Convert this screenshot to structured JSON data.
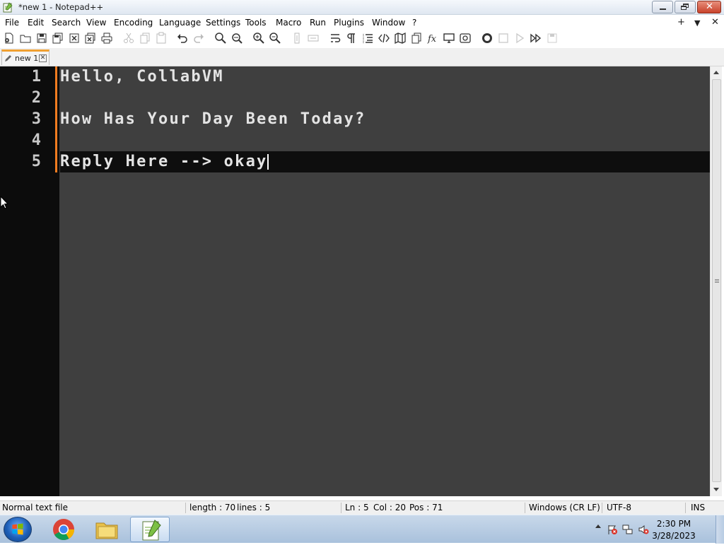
{
  "window": {
    "title": "*new 1 - Notepad++"
  },
  "menubar": {
    "items": [
      "File",
      "Edit",
      "Search",
      "View",
      "Encoding",
      "Language",
      "Settings",
      "Tools",
      "Macro",
      "Run",
      "Plugins",
      "Window",
      "?"
    ],
    "right_controls": [
      "+",
      "▼",
      "✕"
    ]
  },
  "toolbar": {
    "icons": [
      "new-file-icon",
      "open-file-icon",
      "save-icon",
      "save-all-icon",
      "close-icon",
      "close-all-icon",
      "print-icon",
      "cut-icon",
      "copy-icon",
      "paste-icon",
      "undo-icon",
      "redo-icon",
      "find-icon",
      "replace-icon",
      "zoom-in-icon",
      "zoom-out-icon",
      "sync-vertical-icon",
      "sync-horizontal-icon",
      "word-wrap-icon",
      "show-all-characters-icon",
      "indent-guide-icon",
      "xml-tag-icon",
      "document-map-icon",
      "document-list-icon",
      "function-list-icon",
      "monitoring-icon",
      "folder-as-workspace-icon",
      "record-macro-icon",
      "stop-recording-icon",
      "playback-icon",
      "run-macro-multiple-icon",
      "save-macro-icon"
    ]
  },
  "tab": {
    "label": "new 1",
    "close_symbol": "✕"
  },
  "editor": {
    "lines": [
      {
        "number": "1",
        "text": "Hello, CollabVM"
      },
      {
        "number": "2",
        "text": ""
      },
      {
        "number": "3",
        "text": "How Has Your Day Been Today?"
      },
      {
        "number": "4",
        "text": ""
      },
      {
        "number": "5",
        "text": "Reply Here --> okay"
      }
    ],
    "current_line_index": 4
  },
  "statusbar": {
    "file_type": "Normal text file",
    "length": "length : 70",
    "lines": "lines : 5",
    "ln": "Ln : 5",
    "col": "Col : 20",
    "pos": "Pos : 71",
    "eol": "Windows (CR LF)",
    "encoding": "UTF-8",
    "mode": "INS"
  },
  "taskbar": {
    "apps": [
      "start-button",
      "chrome",
      "file-explorer",
      "notepad-plus-plus"
    ],
    "clock_time": "2:30 PM",
    "clock_date": "3/28/2023"
  },
  "colors": {
    "editor_bg": "#3f3f3f",
    "gutter_bg": "#0c0c0c",
    "current_line_bg": "#0e0e0e",
    "change_bar": "#f07c20",
    "text": "#e4e4e4"
  }
}
